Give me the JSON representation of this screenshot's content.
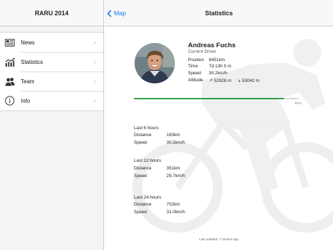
{
  "sidebar": {
    "title": "RARU 2014",
    "items": [
      {
        "label": "News",
        "icon": "newspaper-icon"
      },
      {
        "label": "Statistics",
        "icon": "chart-icon"
      },
      {
        "label": "Team",
        "icon": "team-icon"
      },
      {
        "label": "Info",
        "icon": "info-icon"
      }
    ]
  },
  "navbar": {
    "back_label": "Map",
    "title": "Statistics"
  },
  "driver": {
    "name": "Andreas Fuchs",
    "role": "Current Driver",
    "position_label": "Position",
    "position_value": "8451km",
    "time_label": "Time",
    "time_value": "7d 13h 0 m",
    "speed_label": "Speed",
    "speed_value": "30.2km/h",
    "altitude_label": "Altitude",
    "altitude_up": "↗ 52928 m",
    "altitude_down": "↘ 53042 m"
  },
  "progress": {
    "value_fraction": 0.91,
    "label": "9271"
  },
  "periods": [
    {
      "title": "Last 6 hours",
      "distance_label": "Distance",
      "distance": "183km",
      "speed_label": "Speed",
      "speed": "30.5km/h"
    },
    {
      "title": "Last 12 hours",
      "distance_label": "Distance",
      "distance": "351km",
      "speed_label": "Speed",
      "speed": "29.7km/h"
    },
    {
      "title": "Last 24 hours",
      "distance_label": "Distance",
      "distance": "702km",
      "speed_label": "Speed",
      "speed": "31.0km/h"
    }
  ],
  "footer": {
    "last_updated": "Last updated: 7 minutes ago"
  },
  "colors": {
    "accent": "#1a7cf6",
    "progress": "#2f9e44"
  }
}
